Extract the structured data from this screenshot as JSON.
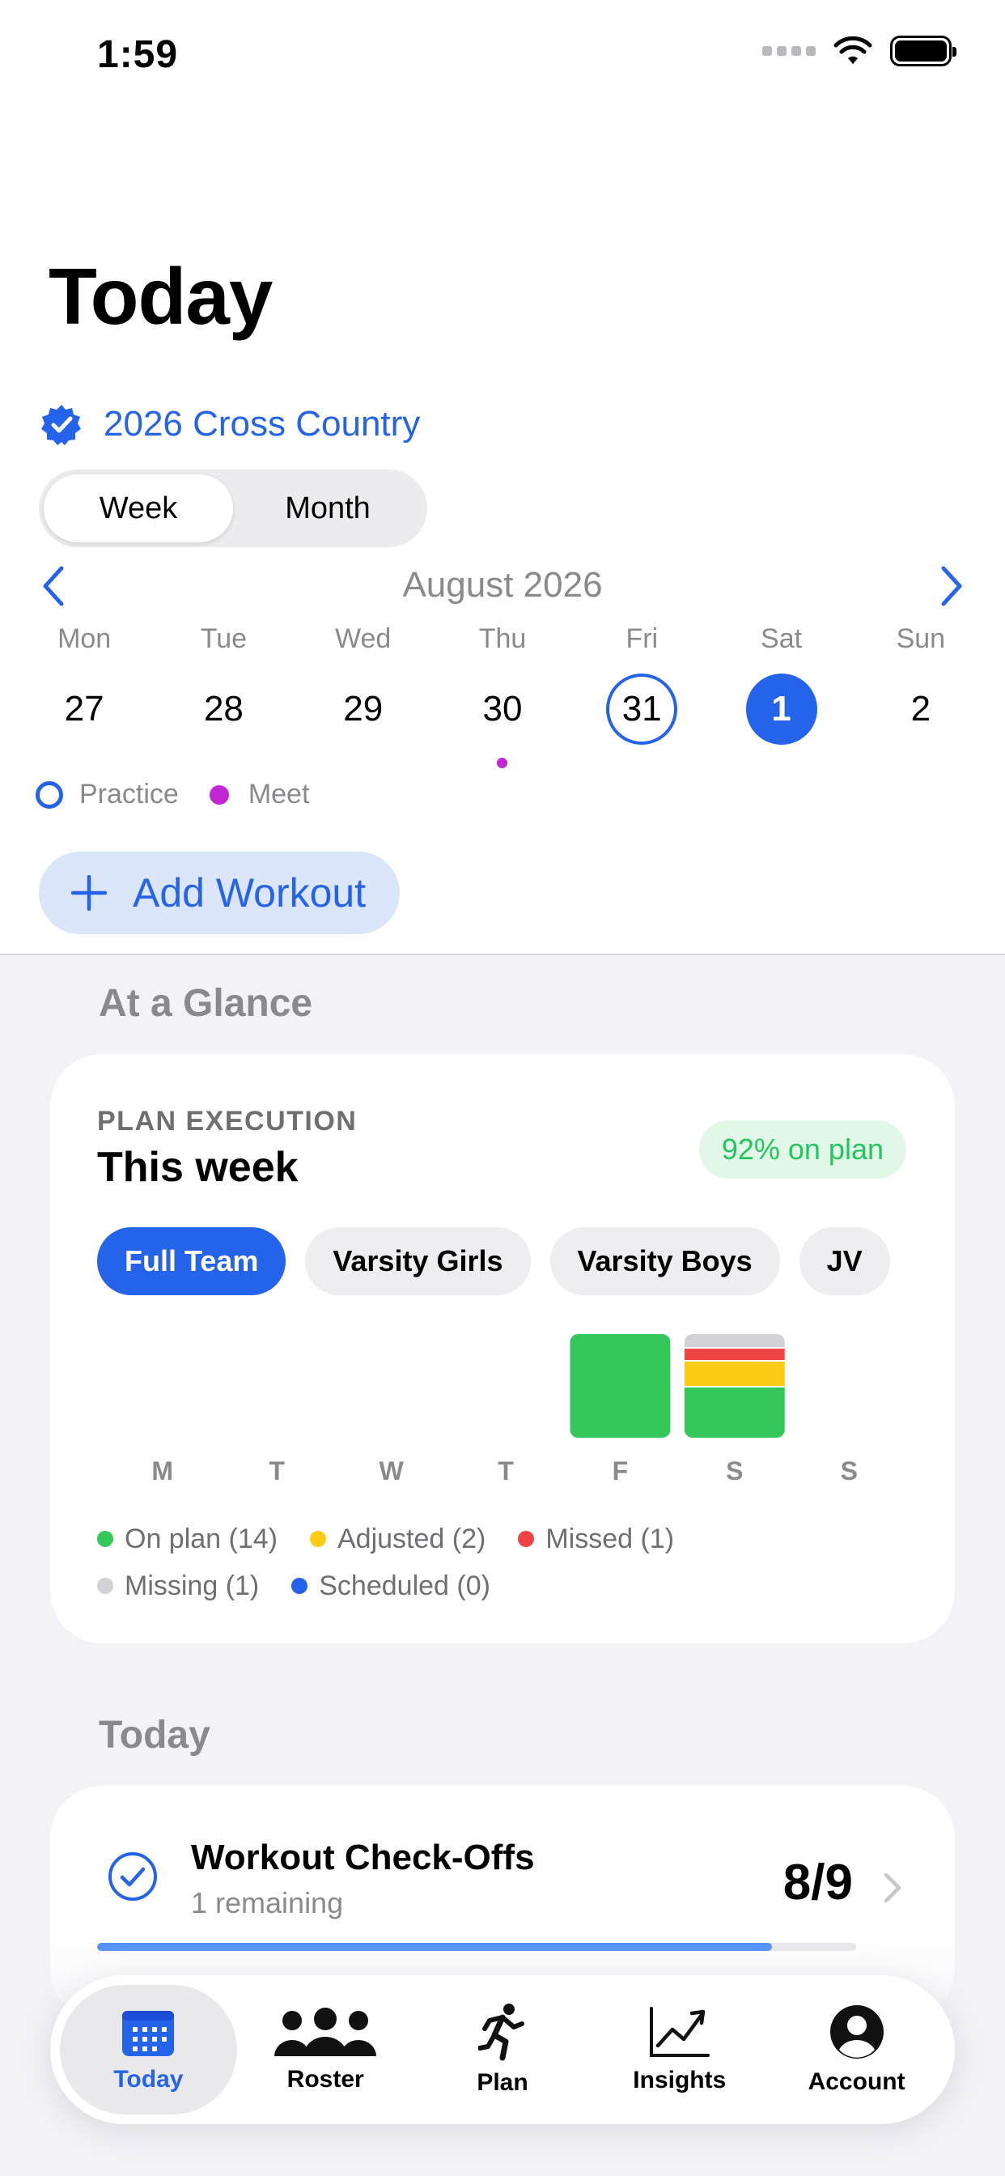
{
  "status": {
    "time": "1:59"
  },
  "header": {
    "title": "Today",
    "season": "2026 Cross Country"
  },
  "view_toggle": {
    "options": [
      "Week",
      "Month"
    ],
    "selected": "Week"
  },
  "calendar": {
    "month": "August 2026",
    "days": [
      {
        "dow": "Mon",
        "num": "27",
        "state": "",
        "meet": false
      },
      {
        "dow": "Tue",
        "num": "28",
        "state": "",
        "meet": false
      },
      {
        "dow": "Wed",
        "num": "29",
        "state": "",
        "meet": false
      },
      {
        "dow": "Thu",
        "num": "30",
        "state": "",
        "meet": true
      },
      {
        "dow": "Fri",
        "num": "31",
        "state": "today",
        "meet": false
      },
      {
        "dow": "Sat",
        "num": "1",
        "state": "selected",
        "meet": false
      },
      {
        "dow": "Sun",
        "num": "2",
        "state": "",
        "meet": false
      }
    ],
    "legend": {
      "practice": "Practice",
      "meet": "Meet"
    }
  },
  "add_workout": {
    "label": "Add Workout"
  },
  "glance": {
    "section_title": "At a Glance",
    "eyebrow": "PLAN EXECUTION",
    "title": "This week",
    "badge": "92% on plan",
    "chips": [
      "Full Team",
      "Varsity Girls",
      "Varsity Boys",
      "JV"
    ],
    "selected_chip": "Full Team",
    "legend": [
      {
        "label": "On plan (14)",
        "color": "#34c759"
      },
      {
        "label": "Adjusted (2)",
        "color": "#facc15"
      },
      {
        "label": "Missed (1)",
        "color": "#ef4444"
      },
      {
        "label": "Missing (1)",
        "color": "#d1d1d6"
      },
      {
        "label": "Scheduled (0)",
        "color": "#2563eb"
      }
    ]
  },
  "chart_data": {
    "type": "bar",
    "stacked": true,
    "categories": [
      "M",
      "T",
      "W",
      "T",
      "F",
      "S",
      "S"
    ],
    "series": [
      {
        "name": "On plan",
        "color": "#34c759",
        "values": [
          0,
          0,
          0,
          0,
          1.0,
          0.5,
          0
        ]
      },
      {
        "name": "Adjusted",
        "color": "#facc15",
        "values": [
          0,
          0,
          0,
          0,
          0,
          0.25,
          0
        ]
      },
      {
        "name": "Missed",
        "color": "#ef4444",
        "values": [
          0,
          0,
          0,
          0,
          0,
          0.125,
          0
        ]
      },
      {
        "name": "Missing",
        "color": "#d1d1d6",
        "values": [
          0,
          0,
          0,
          0,
          0,
          0.125,
          0
        ]
      },
      {
        "name": "Scheduled",
        "color": "#2563eb",
        "values": [
          0,
          0,
          0,
          0,
          0,
          0,
          0
        ]
      }
    ],
    "ylim": [
      0,
      1
    ]
  },
  "today": {
    "section_title": "Today",
    "checkoffs": {
      "title": "Workout Check-Offs",
      "subtitle": "1 remaining",
      "count": "8/9",
      "progress": 0.889
    }
  },
  "tabs": [
    {
      "label": "Today",
      "icon": "calendar-icon",
      "active": true
    },
    {
      "label": "Roster",
      "icon": "people-icon",
      "active": false
    },
    {
      "label": "Plan",
      "icon": "runner-icon",
      "active": false
    },
    {
      "label": "Insights",
      "icon": "chart-line-icon",
      "active": false
    },
    {
      "label": "Account",
      "icon": "person-circle-icon",
      "active": false
    }
  ]
}
